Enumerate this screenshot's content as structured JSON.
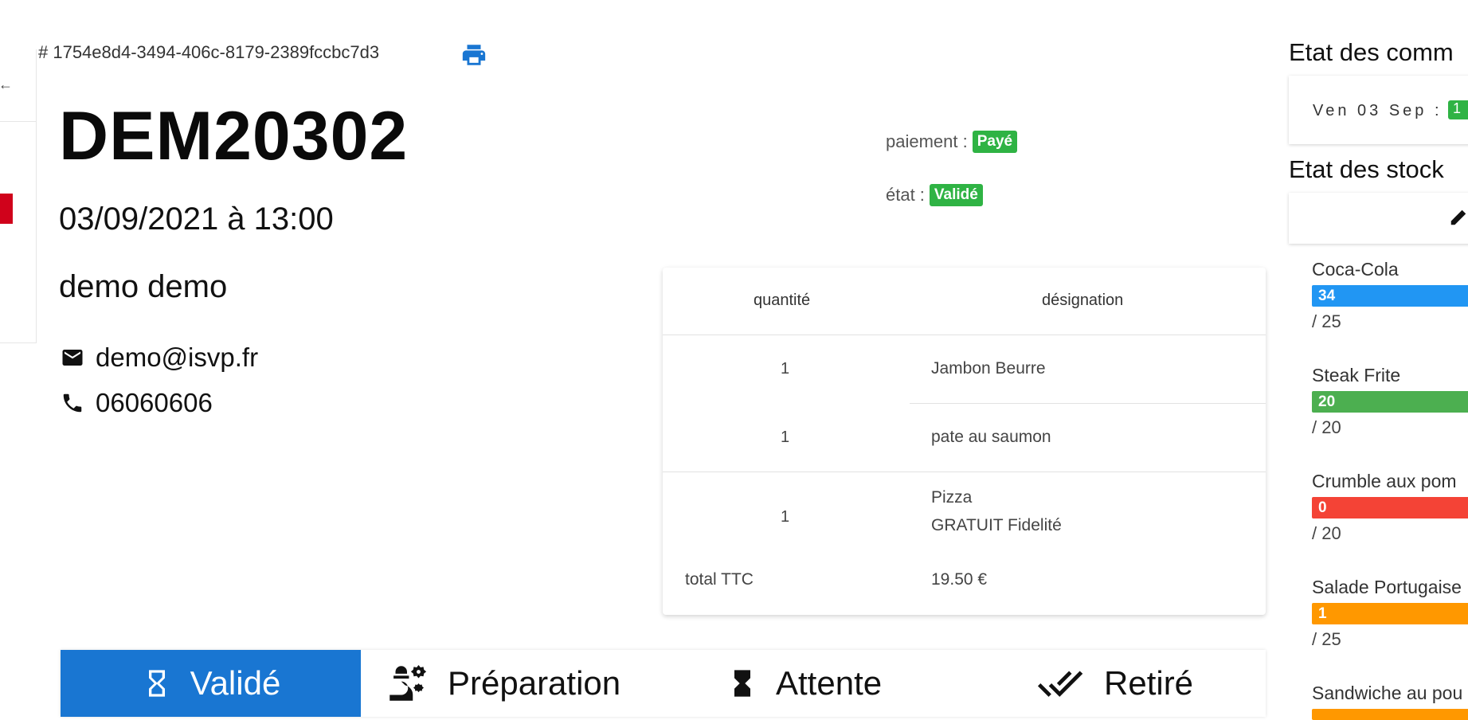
{
  "order": {
    "id": "# 1754e8d4-3494-406c-8179-2389fccbc7d3",
    "reference": "DEM20302",
    "datetime": "03/09/2021 à 13:00",
    "customer": "demo demo",
    "email": "demo@isvp.fr",
    "phone": "06060606"
  },
  "status": {
    "payment_label": "paiement :",
    "payment_value": "Payé",
    "state_label": "état :",
    "state_value": "Validé",
    "badge_color": "#2fb344"
  },
  "items": {
    "headers": {
      "quantity": "quantité",
      "designation": "désignation"
    },
    "rows": [
      {
        "qty": "1",
        "designation": "Jambon Beurre",
        "note": ""
      },
      {
        "qty": "1",
        "designation": "pate au saumon",
        "note": ""
      },
      {
        "qty": "1",
        "designation": "Pizza",
        "note": "GRATUIT Fidelité"
      }
    ],
    "total_label": "total TTC",
    "total_value": "19.50 €"
  },
  "workflow": {
    "accent": "#1976d2",
    "steps": [
      {
        "label": "Validé",
        "icon": "hourglass-empty-icon",
        "active": true
      },
      {
        "label": "Préparation",
        "icon": "chef-gears-icon",
        "active": false
      },
      {
        "label": "Attente",
        "icon": "hourglass-full-icon",
        "active": false
      },
      {
        "label": "Retiré",
        "icon": "double-check-icon",
        "active": false
      }
    ]
  },
  "sidebar": {
    "orders_title": "Etat des comm",
    "orders_day": "Ven 03 Sep :",
    "orders_count": "1",
    "stocks_title": "Etat des stock",
    "stocks": [
      {
        "name": "Coca-Cola",
        "value": "34",
        "max": "/ 25",
        "color": "#2196f3"
      },
      {
        "name": "Steak Frite",
        "value": "20",
        "max": "/ 20",
        "color": "#4caf50"
      },
      {
        "name": "Crumble aux pom",
        "value": "0",
        "max": "/ 20",
        "color": "#f44336"
      },
      {
        "name": "Salade Portugaise",
        "value": "1",
        "max": "/ 25",
        "color": "#ff9800"
      },
      {
        "name": "Sandwiche au pou",
        "value": "",
        "max": "",
        "color": "#ff9800"
      }
    ]
  }
}
